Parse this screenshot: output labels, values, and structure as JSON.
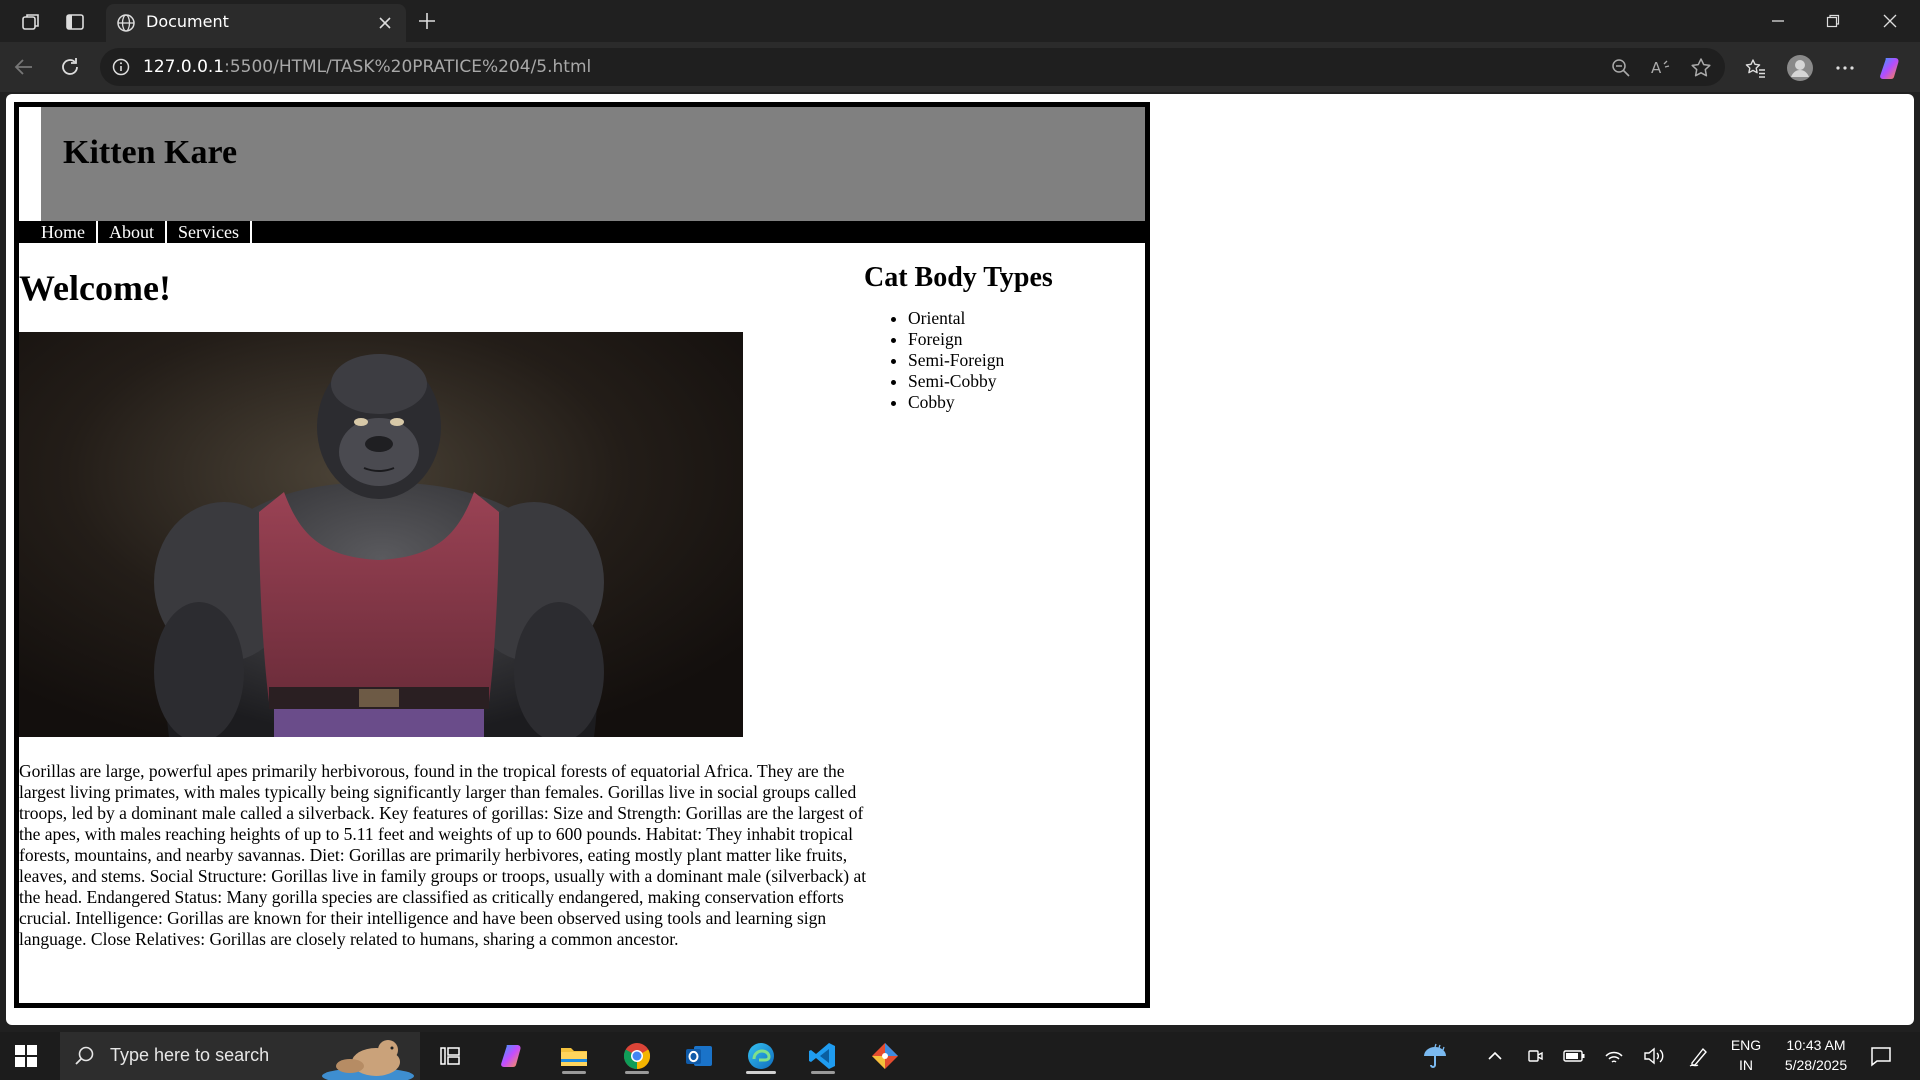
{
  "browser": {
    "tab_title": "Document",
    "url_host": "127.0.0.1",
    "url_path": ":5500/HTML/TASK%20PRATICE%204/5.html",
    "icons": [
      "workspaces-icon",
      "tab-actions-icon",
      "globe-icon",
      "close-icon",
      "plus-icon",
      "back-icon",
      "refresh-icon",
      "info-icon",
      "zoom-out-icon",
      "read-aloud-icon",
      "favorite-star-icon",
      "favorites-icon",
      "profile-icon",
      "more-icon",
      "copilot-icon"
    ]
  },
  "page": {
    "site_title": "Kitten Kare",
    "nav": [
      "Home",
      "About",
      "Services"
    ],
    "heading": "Welcome!",
    "image_alt": "gorilla-portrait",
    "article": "Gorillas are large, powerful apes primarily herbivorous, found in the tropical forests of equatorial Africa. They are the largest living primates, with males typically being significantly larger than females. Gorillas live in social groups called troops, led by a dominant male called a silverback. Key features of gorillas: Size and Strength: Gorillas are the largest of the apes, with males reaching heights of up to 5.11 feet and weights of up to 600 pounds. Habitat: They inhabit tropical forests, mountains, and nearby savannas. Diet: Gorillas are primarily herbivores, eating mostly plant matter like fruits, leaves, and stems. Social Structure: Gorillas live in family groups or troops, usually with a dominant male (silverback) at the head. Endangered Status: Many gorilla species are classified as critically endangered, making conservation efforts crucial. Intelligence: Gorillas are known for their intelligence and have been observed using tools and learning sign language. Close Relatives: Gorillas are closely related to humans, sharing a common ancestor.",
    "aside_title": "Cat Body Types",
    "aside_items": [
      "Oriental",
      "Foreign",
      "Semi-Foreign",
      "Semi-Cobby",
      "Cobby"
    ]
  },
  "taskbar": {
    "search_placeholder": "Type here to search",
    "lang_top": "ENG",
    "lang_bottom": "IN",
    "time": "10:43 AM",
    "date": "5/28/2025"
  },
  "colors": {
    "browser_bg": "#202020",
    "toolbar_bg": "#2b2b2b",
    "header_gray": "#808080",
    "nav_black": "#000000"
  }
}
